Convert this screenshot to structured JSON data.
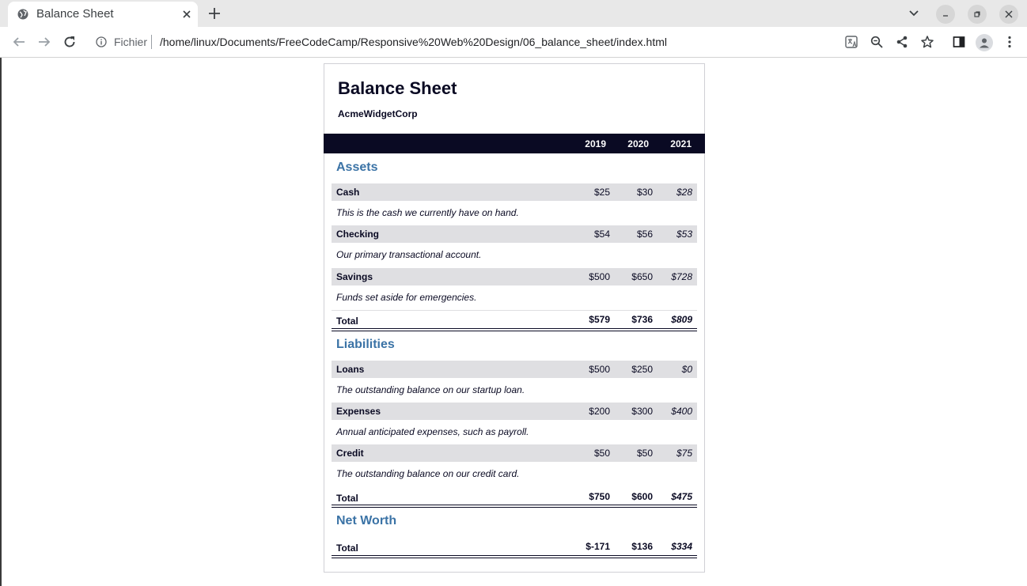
{
  "browser": {
    "tab_title": "Balance Sheet",
    "url_scheme": "Fichier",
    "url": "/home/linux/Documents/FreeCodeCamp/Responsive%20Web%20Design/06_balance_sheet/index.html"
  },
  "sheet": {
    "title": "Balance Sheet",
    "company": "AcmeWidgetCorp",
    "years": [
      "2019",
      "2020",
      "2021"
    ],
    "assets": {
      "title": "Assets",
      "rows": [
        {
          "label": "Cash",
          "values": [
            "$25",
            "$30",
            "$28"
          ],
          "description": "This is the cash we currently have on hand."
        },
        {
          "label": "Checking",
          "values": [
            "$54",
            "$56",
            "$53"
          ],
          "description": "Our primary transactional account."
        },
        {
          "label": "Savings",
          "values": [
            "$500",
            "$650",
            "$728"
          ],
          "description": "Funds set aside for emergencies."
        }
      ],
      "total": {
        "label": "Total",
        "values": [
          "$579",
          "$736",
          "$809"
        ]
      }
    },
    "liabilities": {
      "title": "Liabilities",
      "rows": [
        {
          "label": "Loans",
          "values": [
            "$500",
            "$250",
            "$0"
          ],
          "description": "The outstanding balance on our startup loan."
        },
        {
          "label": "Expenses",
          "values": [
            "$200",
            "$300",
            "$400"
          ],
          "description": "Annual anticipated expenses, such as payroll."
        },
        {
          "label": "Credit",
          "values": [
            "$50",
            "$50",
            "$75"
          ],
          "description": "The outstanding balance on our credit card."
        }
      ],
      "total": {
        "label": "Total",
        "values": [
          "$750",
          "$600",
          "$475"
        ]
      }
    },
    "net_worth": {
      "title": "Net Worth",
      "total": {
        "label": "Total",
        "values": [
          "$-171",
          "$136",
          "$334"
        ]
      }
    }
  }
}
